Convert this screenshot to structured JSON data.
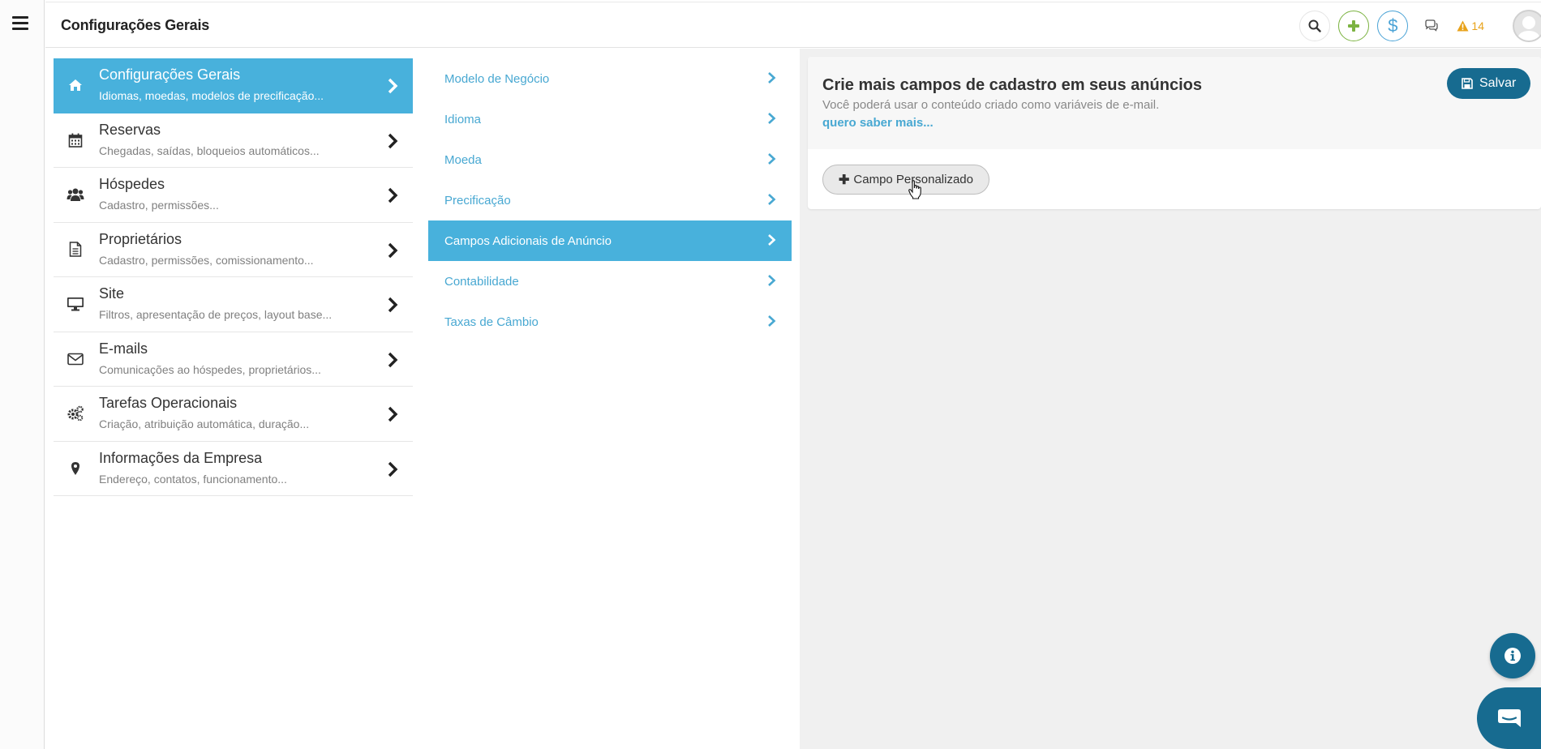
{
  "header": {
    "title": "Configurações Gerais",
    "alert_count": "14"
  },
  "categories": [
    {
      "title": "Configurações Gerais",
      "subtitle": "Idiomas, moedas, modelos de precificação...",
      "icon": "home-icon",
      "active": true
    },
    {
      "title": "Reservas",
      "subtitle": "Chegadas, saídas, bloqueios automáticos...",
      "icon": "calendar-icon"
    },
    {
      "title": "Hóspedes",
      "subtitle": "Cadastro, permissões...",
      "icon": "users-icon"
    },
    {
      "title": "Proprietários",
      "subtitle": "Cadastro, permissões, comissionamento...",
      "icon": "document-icon"
    },
    {
      "title": "Site",
      "subtitle": "Filtros, apresentação de preços, layout base...",
      "icon": "monitor-icon"
    },
    {
      "title": "E-mails",
      "subtitle": "Comunicações ao hóspedes, proprietários...",
      "icon": "envelope-icon"
    },
    {
      "title": "Tarefas Operacionais",
      "subtitle": "Criação, atribuição automática, duração...",
      "icon": "gears-icon"
    },
    {
      "title": "Informações da Empresa",
      "subtitle": "Endereço, contatos, funcionamento...",
      "icon": "map-pin-icon"
    }
  ],
  "subnav": [
    {
      "label": "Modelo de Negócio"
    },
    {
      "label": "Idioma"
    },
    {
      "label": "Moeda"
    },
    {
      "label": "Precificação"
    },
    {
      "label": "Campos Adicionais de Anúncio",
      "active": true
    },
    {
      "label": "Contabilidade"
    },
    {
      "label": "Taxas de Câmbio"
    }
  ],
  "panel": {
    "title": "Crie mais campos de cadastro em seus anúncios",
    "description": "Você poderá usar o conteúdo criado como variáveis de e-mail.",
    "link": "quero saber mais...",
    "save_label": "Salvar",
    "custom_field_label": "Campo Personalizado"
  },
  "colors": {
    "accent": "#48b1dc",
    "primary_dark": "#176b90",
    "link": "#48a8d2",
    "warning": "#e8a21a",
    "success": "#7cb342"
  }
}
